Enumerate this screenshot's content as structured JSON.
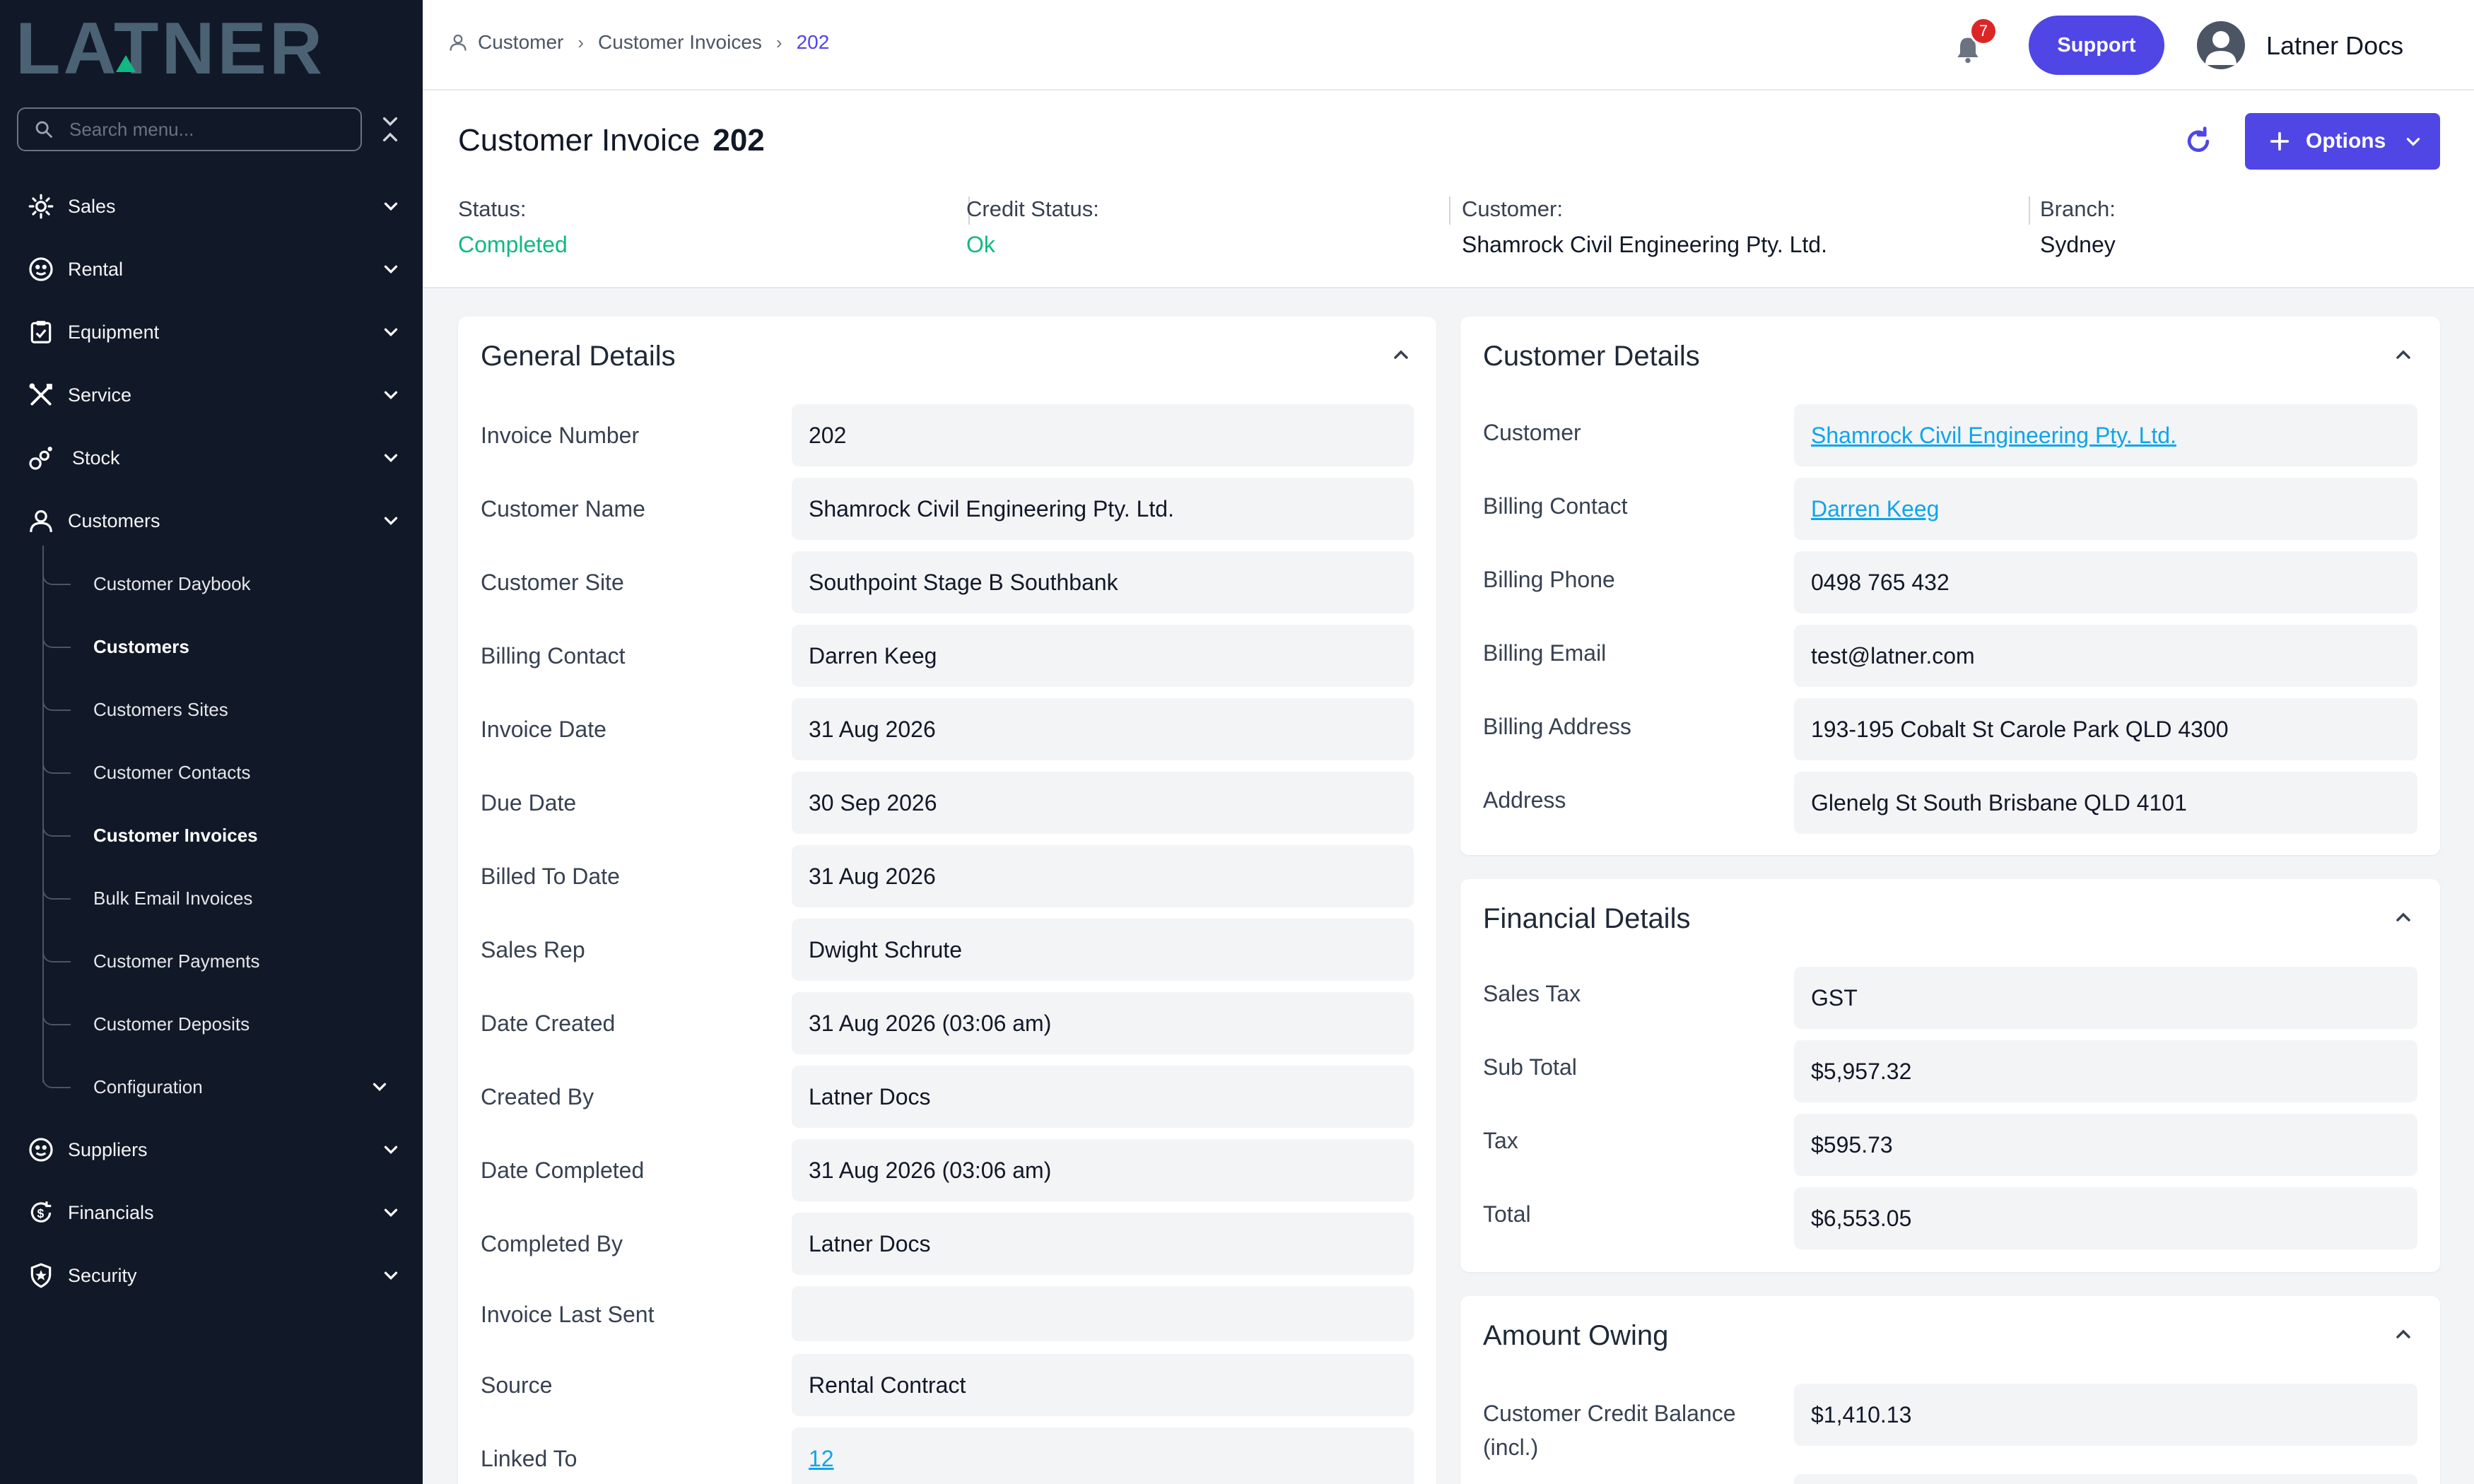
{
  "brand": {
    "logo_text": "LATNER",
    "logo_color": "#4b6275",
    "accent": "#10b981"
  },
  "sidebar": {
    "search_placeholder": "Search menu...",
    "items": [
      {
        "id": "sales",
        "label": "Sales",
        "icon": "sun-icon"
      },
      {
        "id": "rental",
        "label": "Rental",
        "icon": "rental-icon"
      },
      {
        "id": "equipment",
        "label": "Equipment",
        "icon": "clipboard-icon"
      },
      {
        "id": "service",
        "label": "Service",
        "icon": "tools-icon"
      },
      {
        "id": "stock",
        "label": "Stock",
        "icon": "stock-icon"
      },
      {
        "id": "customers",
        "label": "Customers",
        "icon": "user-icon"
      },
      {
        "id": "suppliers",
        "label": "Suppliers",
        "icon": "rental-icon"
      },
      {
        "id": "financials",
        "label": "Financials",
        "icon": "dollar-cycle-icon"
      },
      {
        "id": "security",
        "label": "Security",
        "icon": "shield-icon"
      }
    ],
    "customers_sub": [
      {
        "label": "Customer Daybook",
        "active": false
      },
      {
        "label": "Customers",
        "active": true
      },
      {
        "label": "Customers Sites",
        "active": false
      },
      {
        "label": "Customer Contacts",
        "active": false
      },
      {
        "label": "Customer Invoices",
        "active": true
      },
      {
        "label": "Bulk Email Invoices",
        "active": false
      },
      {
        "label": "Customer Payments",
        "active": false
      },
      {
        "label": "Customer Deposits",
        "active": false
      },
      {
        "label": "Configuration",
        "active": false
      }
    ]
  },
  "topbar": {
    "breadcrumb": [
      "Customer",
      "Customer Invoices",
      "202"
    ],
    "notifications": "7",
    "support_label": "Support",
    "user_name": "Latner Docs"
  },
  "header": {
    "title": "Customer Invoice",
    "number": "202",
    "options_label": "Options",
    "status_label": "Status:",
    "status_value": "Completed",
    "credit_label": "Credit Status:",
    "credit_value": "Ok",
    "customer_label": "Customer:",
    "customer_value": "Shamrock Civil Engineering Pty. Ltd.",
    "branch_label": "Branch:",
    "branch_value": "Sydney"
  },
  "general": {
    "title": "General Details",
    "rows": [
      {
        "label": "Invoice Number",
        "value": "202"
      },
      {
        "label": "Customer Name",
        "value": "Shamrock Civil Engineering Pty. Ltd."
      },
      {
        "label": "Customer Site",
        "value": "Southpoint Stage B Southbank"
      },
      {
        "label": "Billing Contact",
        "value": "Darren Keeg"
      },
      {
        "label": "Invoice Date",
        "value": "31 Aug 2026"
      },
      {
        "label": "Due Date",
        "value": "30 Sep 2026"
      },
      {
        "label": "Billed To Date",
        "value": "31 Aug 2026"
      },
      {
        "label": "Sales Rep",
        "value": "Dwight Schrute"
      },
      {
        "label": "Date Created",
        "value": "31 Aug 2026 (03:06 am)"
      },
      {
        "label": "Created By",
        "value": "Latner Docs"
      },
      {
        "label": "Date Completed",
        "value": "31 Aug 2026 (03:06 am)"
      },
      {
        "label": "Completed By",
        "value": "Latner Docs"
      },
      {
        "label": "Invoice Last Sent",
        "value": ""
      },
      {
        "label": "Source",
        "value": "Rental Contract"
      },
      {
        "label": "Linked To",
        "value": "12"
      }
    ]
  },
  "customer_details": {
    "title": "Customer Details",
    "rows": [
      {
        "label": "Customer",
        "value": "Shamrock Civil Engineering Pty. Ltd."
      },
      {
        "label": "Billing Contact",
        "value": "Darren Keeg"
      },
      {
        "label": "Billing Phone",
        "value": "0498 765 432"
      },
      {
        "label": "Billing Email",
        "value": "test@latner.com"
      },
      {
        "label": "Billing Address",
        "value": "193-195 Cobalt St Carole Park QLD 4300"
      },
      {
        "label": "Address",
        "value": "Glenelg St South Brisbane QLD 4101"
      }
    ]
  },
  "financial": {
    "title": "Financial Details",
    "rows": [
      {
        "label": "Sales Tax",
        "value": "GST"
      },
      {
        "label": "Sub Total",
        "value": "$5,957.32"
      },
      {
        "label": "Tax",
        "value": "$595.73"
      },
      {
        "label": "Total",
        "value": "$6,553.05"
      }
    ]
  },
  "owing": {
    "title": "Amount Owing",
    "rows": [
      {
        "label": "Customer Credit Balance",
        "label2": "(incl.)",
        "value": "$1,410.13"
      }
    ]
  }
}
